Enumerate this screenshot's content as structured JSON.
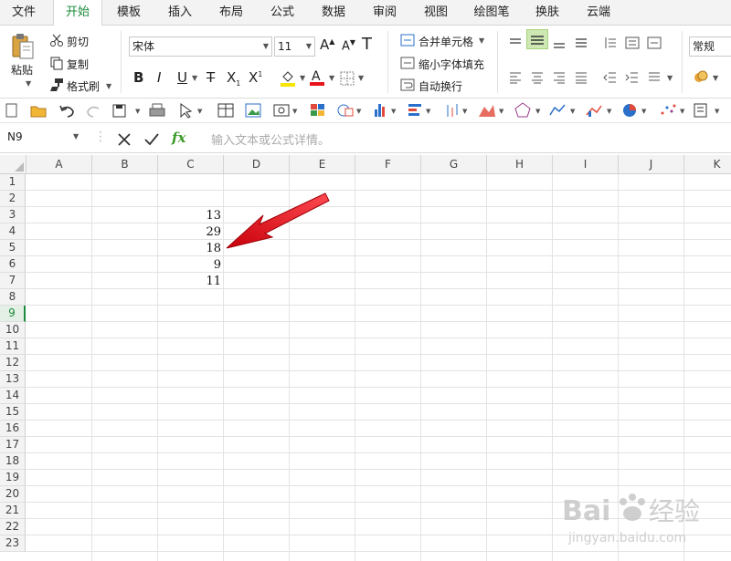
{
  "tabs": [
    "文件",
    "开始",
    "模板",
    "插入",
    "布局",
    "公式",
    "数据",
    "审阅",
    "视图",
    "绘图笔",
    "换肤",
    "云端"
  ],
  "active_tab": "开始",
  "clipboard": {
    "paste": "粘贴",
    "cut": "剪切",
    "copy": "复制",
    "format_painter": "格式刷"
  },
  "font": {
    "name": "宋体",
    "size": "11"
  },
  "alignment": {
    "merge": "合并单元格",
    "shrink": "缩小字体填充",
    "wrap": "自动换行"
  },
  "number_format": "常规",
  "formula_bar": {
    "cell_ref": "N9",
    "fx": "fx",
    "placeholder": "输入文本或公式详情。"
  },
  "columns": [
    "A",
    "B",
    "C",
    "D",
    "E",
    "F",
    "G",
    "H",
    "I",
    "J",
    "K"
  ],
  "rows": [
    "1",
    "2",
    "3",
    "4",
    "5",
    "6",
    "7",
    "8",
    "9",
    "10",
    "11",
    "12",
    "13",
    "14",
    "15",
    "16",
    "17",
    "18",
    "19",
    "20",
    "21",
    "22",
    "23"
  ],
  "cells": [
    {
      "ref": "C3",
      "value": "13"
    },
    {
      "ref": "C4",
      "value": "29"
    },
    {
      "ref": "C5",
      "value": "18"
    },
    {
      "ref": "C6",
      "value": "9"
    },
    {
      "ref": "C7",
      "value": "11"
    }
  ],
  "selected_row": "9",
  "accent": "#1c8b3c",
  "annotation_color": "#e8141c",
  "watermark": {
    "brand": "Bai经验",
    "url": "jingyan.baidu.com"
  }
}
